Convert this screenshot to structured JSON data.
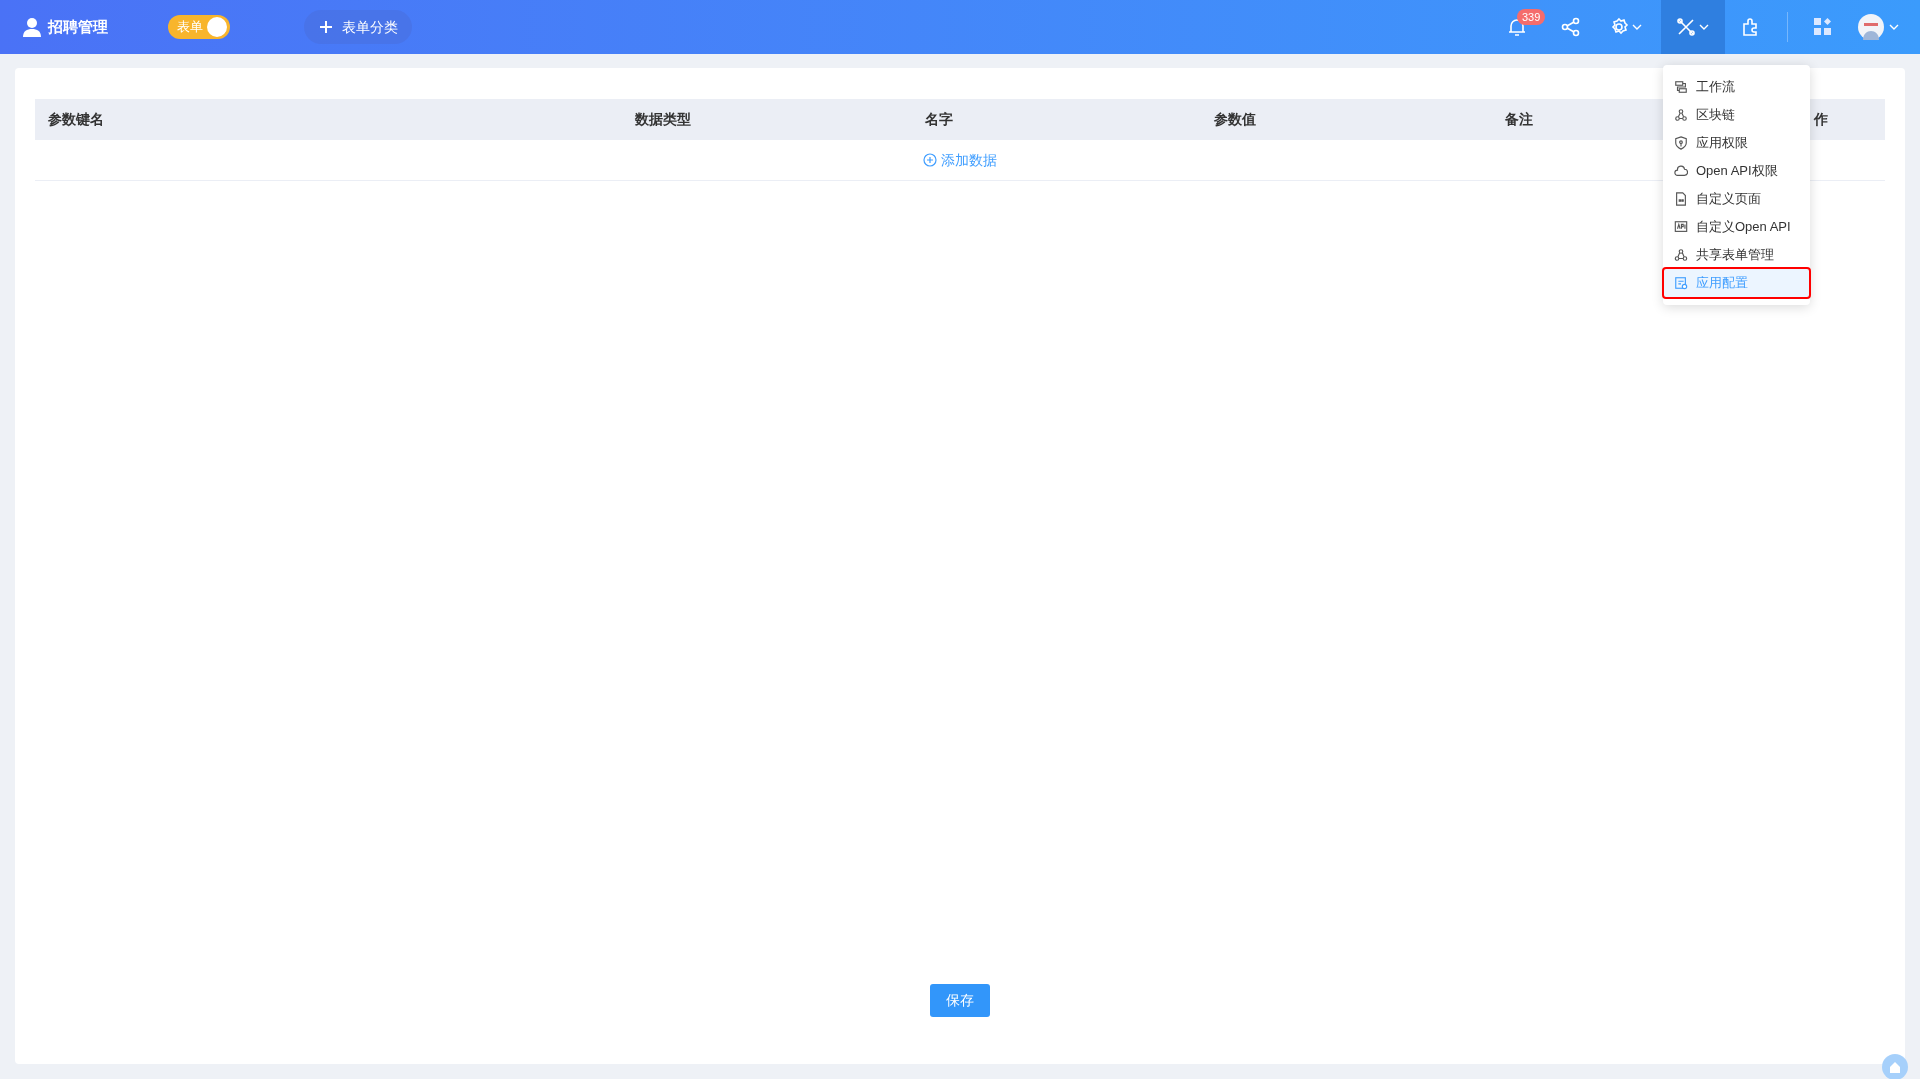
{
  "header": {
    "app_title": "招聘管理",
    "toggle": {
      "label": "表单",
      "on": true
    },
    "category_button": "表单分类",
    "notification_count": "339"
  },
  "table": {
    "columns": [
      "参数键名",
      "数据类型",
      "名字",
      "参数值",
      "备注",
      "作"
    ],
    "add_row": "添加数据"
  },
  "tools_menu": {
    "open": true,
    "items": [
      {
        "kind": "workflow",
        "label": "工作流",
        "selected": false
      },
      {
        "kind": "blockchain",
        "label": "区块链",
        "selected": false
      },
      {
        "kind": "shield",
        "label": "应用权限",
        "selected": false
      },
      {
        "kind": "cloud",
        "label": "Open API权限",
        "selected": false
      },
      {
        "kind": "page",
        "label": "自定义页面",
        "selected": false
      },
      {
        "kind": "api",
        "label": "自定义Open API",
        "selected": false
      },
      {
        "kind": "share",
        "label": "共享表单管理",
        "selected": false
      },
      {
        "kind": "config",
        "label": "应用配置",
        "selected": true
      }
    ]
  },
  "save_button": "保存"
}
